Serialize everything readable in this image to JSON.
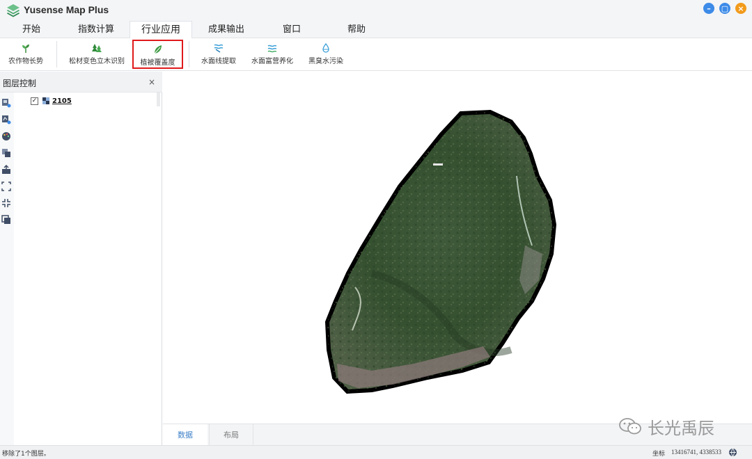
{
  "app": {
    "title": "Yusense Map Plus",
    "logo_icon": "layers-stack-icon"
  },
  "window_controls": {
    "minimize": "–",
    "maximize": "▢",
    "close": "×"
  },
  "menu": {
    "tabs": [
      {
        "label": "开始"
      },
      {
        "label": "指数计算"
      },
      {
        "label": "行业应用",
        "active": true
      },
      {
        "label": "成果输出"
      },
      {
        "label": "窗口"
      },
      {
        "label": "帮助"
      }
    ]
  },
  "ribbon": {
    "buttons": [
      {
        "label": "农作物长势",
        "icon": "crop-sprout-icon"
      },
      {
        "label": "松材变色立木识别",
        "icon": "pine-tree-icon"
      },
      {
        "label": "植被覆盖度",
        "icon": "leaf-icon",
        "selected": true
      },
      {
        "label": "水面线提取",
        "icon": "water-line-icon"
      },
      {
        "label": "水面富营养化",
        "icon": "water-eutrophication-icon"
      },
      {
        "label": "黑臭水污染",
        "icon": "water-pollution-icon"
      }
    ]
  },
  "layer_panel": {
    "title": "图层控制",
    "close": "×",
    "layers": [
      {
        "name": "2105",
        "checked": true,
        "check_mark": "✓"
      }
    ],
    "tools": [
      "add-raster-icon",
      "add-vector-icon",
      "palette-icon",
      "copy-layer-icon",
      "export-layer-icon",
      "full-extent-icon",
      "zoom-layer-icon",
      "duplicate-icon"
    ]
  },
  "bottom_tabs": {
    "data": "数据",
    "layout": "布局"
  },
  "watermark": {
    "text": "长光禹辰"
  },
  "status": {
    "message": "移除了1个图层。",
    "coord_label": "坐标",
    "coords": "13416741, 4338533"
  },
  "colors": {
    "accent": "#3d8be8",
    "close": "#f29b1c",
    "selection": "#e0191b",
    "active_tab_text": "#3f82c9"
  }
}
